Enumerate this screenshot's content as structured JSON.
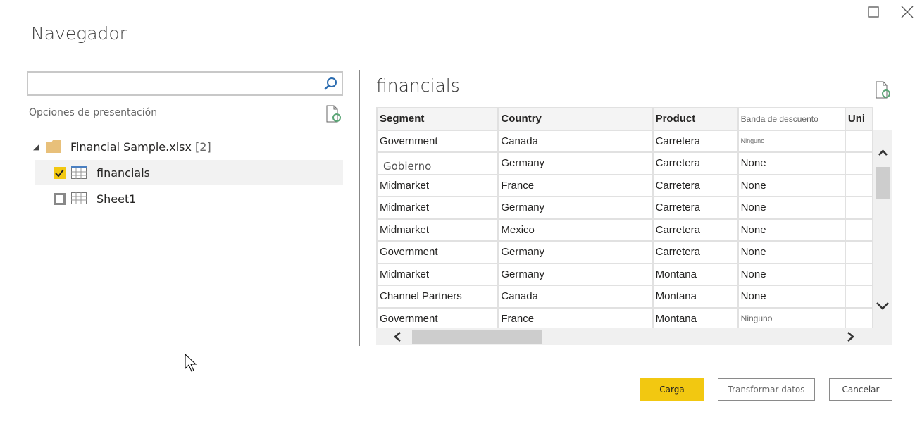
{
  "window": {
    "title": "Navegador",
    "maximize_icon": "square",
    "close_icon": "x"
  },
  "left": {
    "search": {
      "value": "",
      "placeholder": ""
    },
    "display_options": "Opciones de presentación",
    "file": {
      "name": "Financial Sample.xlsx",
      "count": "[2]"
    },
    "items": [
      {
        "label": "financials",
        "checked": true,
        "selected": true
      },
      {
        "label": "Sheet1",
        "checked": false,
        "selected": false
      }
    ]
  },
  "preview": {
    "title": "financials",
    "columns": [
      "Segment",
      "Country",
      "Product",
      "Banda de descuento",
      "Uni"
    ],
    "rows": [
      [
        "Government",
        "Canada",
        "Carretera",
        "Ninguno"
      ],
      [
        "Gobierno",
        "Germany",
        "Carretera",
        "None"
      ],
      [
        "Midmarket",
        "France",
        "Carretera",
        "None"
      ],
      [
        "Midmarket",
        "Germany",
        "Carretera",
        "None"
      ],
      [
        "Midmarket",
        "Mexico",
        "Carretera",
        "None"
      ],
      [
        "Government",
        "Germany",
        "Carretera",
        "None"
      ],
      [
        "Midmarket",
        "Germany",
        "Montana",
        "None"
      ],
      [
        "Channel Partners",
        "Canada",
        "Montana",
        "None"
      ],
      [
        "Government",
        "France",
        "Montana",
        "Ninguno"
      ]
    ]
  },
  "buttons": {
    "load": "Carga",
    "transform": "Transformar datos",
    "cancel": "Cancelar"
  },
  "colors": {
    "accent": "#f2c811",
    "search_icon": "#2b6cb0",
    "refresh": "#5aa575"
  }
}
